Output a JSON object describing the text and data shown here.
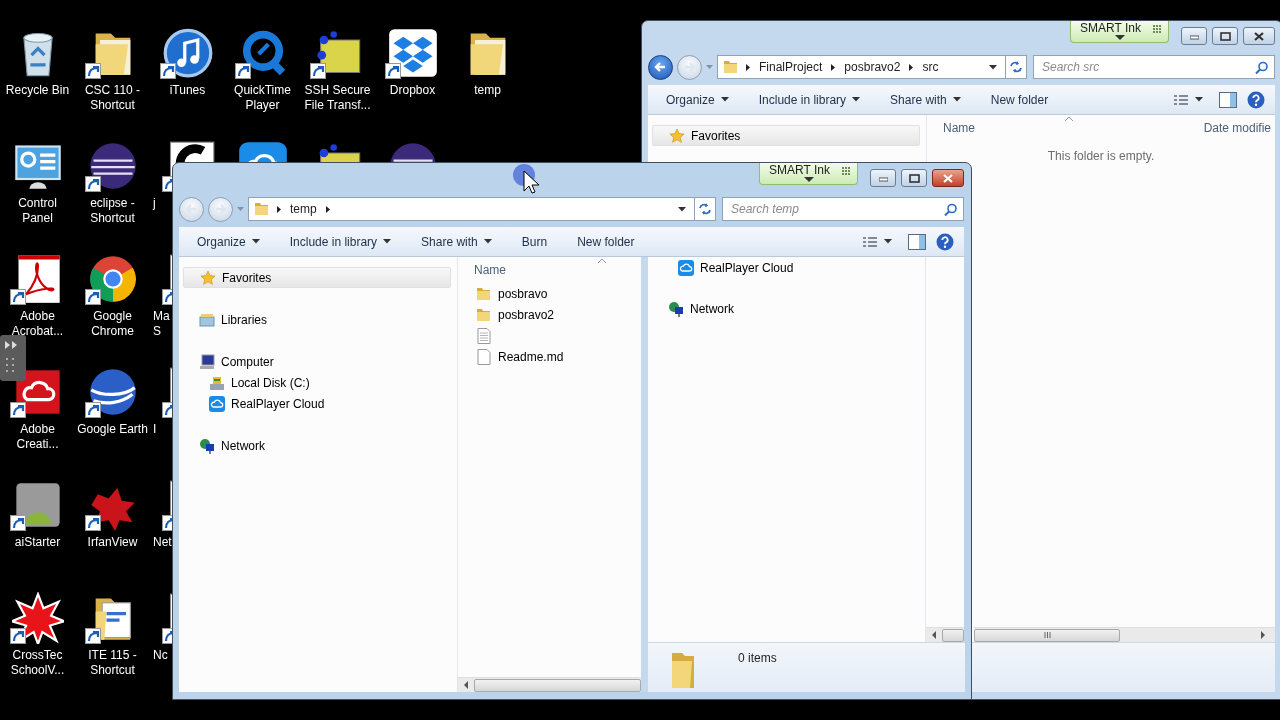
{
  "desktop_columns": [
    [
      {
        "label_lines": [
          "Recycle Bin"
        ],
        "kind": "recycle",
        "shortcut": false
      },
      {
        "label_lines": [
          "Control",
          "Panel"
        ],
        "kind": "panel",
        "shortcut": false
      },
      {
        "label_lines": [
          "Adobe",
          "Acrobat..."
        ],
        "kind": "pdf",
        "shortcut": true
      },
      {
        "label_lines": [
          "Adobe",
          "Creati..."
        ],
        "kind": "creative",
        "shortcut": true
      },
      {
        "label_lines": [
          "aiStarter"
        ],
        "kind": "puzzle",
        "shortcut": true
      },
      {
        "label_lines": [
          "CrossTec",
          "SchoolV..."
        ],
        "kind": "burst",
        "shortcut": true
      }
    ],
    [
      {
        "label_lines": [
          "CSC 110 -",
          "Shortcut"
        ],
        "kind": "folder",
        "shortcut": true
      },
      {
        "label_lines": [
          "eclipse -",
          "Shortcut"
        ],
        "kind": "eclipse",
        "shortcut": true
      },
      {
        "label_lines": [
          "Google",
          "Chrome"
        ],
        "kind": "chrome",
        "shortcut": true
      },
      {
        "label_lines": [
          "Google Earth"
        ],
        "kind": "globe",
        "shortcut": true
      },
      {
        "label_lines": [
          "IrfanView"
        ],
        "kind": "paint",
        "shortcut": true
      },
      {
        "label_lines": [
          "ITE 115 -",
          "Shortcut"
        ],
        "kind": "docfolder",
        "shortcut": true
      }
    ],
    [
      {
        "label_lines": [
          "iTunes"
        ],
        "kind": "music",
        "shortcut": true
      },
      {
        "label_lines": [
          "j"
        ],
        "kind": "script",
        "shortcut": true,
        "clipped": true
      },
      {
        "label_lines": [
          "Ma",
          "S"
        ],
        "kind": "script",
        "shortcut": true,
        "clipped": true
      },
      {
        "label_lines": [
          "I"
        ],
        "kind": "script",
        "shortcut": true,
        "clipped": true
      },
      {
        "label_lines": [
          "Net"
        ],
        "kind": "script",
        "shortcut": true,
        "clipped": true
      },
      {
        "label_lines": [
          "Nc"
        ],
        "kind": "script",
        "shortcut": true,
        "clipped": true
      }
    ],
    [
      {
        "label_lines": [
          "QuickTime",
          "Player"
        ],
        "kind": "player",
        "shortcut": true
      },
      {
        "kind": "cloud"
      }
    ],
    [
      {
        "label_lines": [
          "SSH Secure",
          "File Transf..."
        ],
        "kind": "ssh",
        "shortcut": true
      },
      {
        "kind": "ssh"
      }
    ],
    [
      {
        "label_lines": [
          "Dropbox"
        ],
        "kind": "dropbox",
        "shortcut": true
      },
      {
        "kind": "eclipse"
      }
    ],
    [
      {
        "label_lines": [
          "temp"
        ],
        "kind": "folder",
        "shortcut": false
      }
    ]
  ],
  "back_window": {
    "active": false,
    "title_tag": "SMART Ink",
    "back_enabled": true,
    "path": [
      "FinalProject",
      "posbravo2",
      "src"
    ],
    "trailing_chevron": false,
    "search_placeholder": "Search src",
    "toolbar": [
      {
        "label": "Organize",
        "dropdown": true
      },
      {
        "label": "Include in library",
        "dropdown": true
      },
      {
        "label": "Share with",
        "dropdown": true
      },
      {
        "label": "New folder",
        "dropdown": false
      }
    ],
    "nav": [
      {
        "label": "Favorites",
        "kind": "star",
        "selected": true
      }
    ],
    "columns": [
      "Name",
      "Date modifie"
    ],
    "empty_message": "This folder is empty."
  },
  "front_window": {
    "active": true,
    "title_tag": "SMART Ink",
    "back_enabled": false,
    "path": [
      "temp"
    ],
    "trailing_chevron": true,
    "search_placeholder": "Search temp",
    "toolbar": [
      {
        "label": "Organize",
        "dropdown": true
      },
      {
        "label": "Include in library",
        "dropdown": true
      },
      {
        "label": "Share with",
        "dropdown": true
      },
      {
        "label": "Burn",
        "dropdown": false
      },
      {
        "label": "New folder",
        "dropdown": false
      }
    ],
    "nav": [
      {
        "label": "Favorites",
        "kind": "star",
        "selected": true
      },
      {
        "label": "Libraries",
        "kind": "library",
        "selected": false
      },
      {
        "label": "Computer",
        "kind": "computer",
        "selected": false,
        "children": [
          {
            "label": "Local Disk (C:)",
            "kind": "disk",
            "selected": false
          },
          {
            "label": "RealPlayer Cloud",
            "kind": "cloud",
            "selected": false
          }
        ]
      },
      {
        "label": "Network",
        "kind": "network",
        "selected": false
      }
    ],
    "columns": [
      "Name"
    ],
    "files": [
      {
        "name": "posbravo",
        "kind": "folder"
      },
      {
        "name": "posbravo2",
        "kind": "folder"
      },
      {
        "kind": "text"
      },
      {
        "name": "Readme.md",
        "kind": "file"
      }
    ],
    "ghost_pane": {
      "nav": [
        {
          "label": "RealPlayer Cloud",
          "kind": "cloud",
          "indent": true
        },
        {
          "label": "Network",
          "kind": "network",
          "indent": false
        }
      ],
      "status": "0 items"
    }
  }
}
